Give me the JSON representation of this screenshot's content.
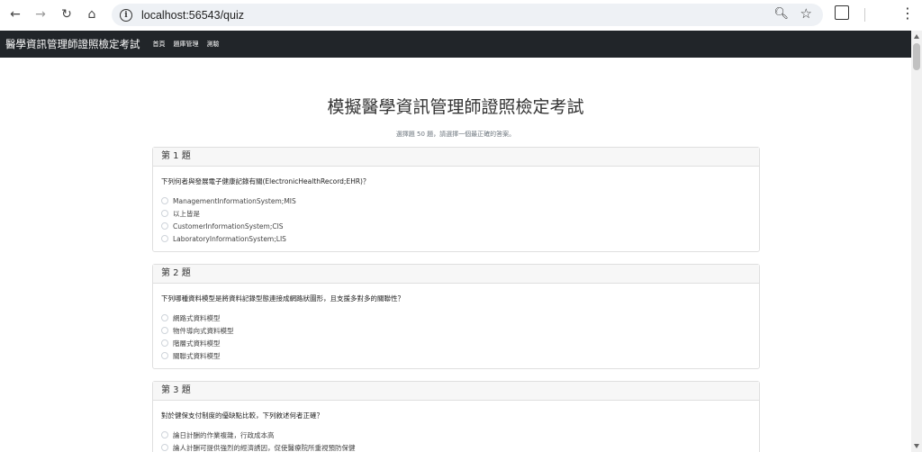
{
  "browser": {
    "url": "localhost:56543/quiz"
  },
  "navbar": {
    "brand": "醫學資訊管理師證照檢定考試",
    "links": [
      "首頁",
      "題庫管理",
      "測驗"
    ]
  },
  "page": {
    "title": "模擬醫學資訊管理師證照檢定考試",
    "subtitle": "選擇題 50 題，請選擇一個最正確的答案。"
  },
  "questions": [
    {
      "header": "第 1 題",
      "text": "下列何者與發展電子健康記錄有關(ElectronicHealthRecord;EHR)？",
      "options": [
        "ManagementInformationSystem;MIS",
        "以上皆是",
        "CustomerInformationSystem;CIS",
        "LaboratoryInformationSystem;LIS"
      ]
    },
    {
      "header": "第 2 題",
      "text": "下列哪種資料模型是將資料記錄型態連接成網路狀圖形，且支援多對多的關聯性？",
      "options": [
        "網路式資料模型",
        "物件導向式資料模型",
        "階層式資料模型",
        "關聯式資料模型"
      ]
    },
    {
      "header": "第 3 題",
      "text": "對於健保支付制度的優缺點比較，下列敘述何者正確？",
      "options": [
        "論日計酬的作業複雜，行政成本高",
        "論人計酬可提供強烈的經濟誘因，促使醫療院所重視預防保健"
      ]
    }
  ]
}
